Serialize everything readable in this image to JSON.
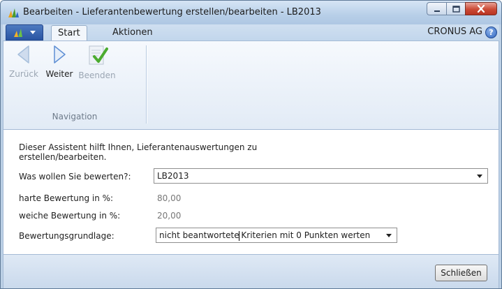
{
  "window": {
    "title": "Bearbeiten - Lieferantenbewertung erstellen/bearbeiten - LB2013"
  },
  "ribbon": {
    "tabs": [
      {
        "label": "Start",
        "active": true
      },
      {
        "label": "Aktionen",
        "active": false
      }
    ],
    "company": "CRONUS AG",
    "help_icon_label": "?",
    "navigation": {
      "group_label": "Navigation",
      "buttons": [
        {
          "label": "Zurück",
          "icon": "arrow-left-icon",
          "enabled": false
        },
        {
          "label": "Weiter",
          "icon": "arrow-right-icon",
          "enabled": true
        },
        {
          "label": "Beenden",
          "icon": "finish-checkmark-icon",
          "enabled": false
        }
      ]
    }
  },
  "form": {
    "intro": "Dieser Assistent hilft Ihnen, Lieferantenauswertungen zu erstellen/bearbeiten.",
    "fields": {
      "evaluate": {
        "label": "Was wollen Sie bewerten?:",
        "value": "LB2013"
      },
      "hard": {
        "label": "harte Bewertung in %:",
        "value": "80,00"
      },
      "soft": {
        "label": "weiche Bewertung in %:",
        "value": "20,00"
      },
      "basis": {
        "label": "Bewertungsgrundlage:",
        "value_before_caret": "nicht beantwortete",
        "value_after_caret": " Kriterien mit 0 Punkten werten"
      }
    }
  },
  "footer": {
    "close_label": "Schließen"
  },
  "colors": {
    "title_bar": "#b8cfe8",
    "close_button": "#cb4a36",
    "app_button": "#2a55a3",
    "nav_arrow_disabled": "#a7bfdc",
    "nav_arrow_enabled": "#5f8fd4",
    "finish_check": "#4bab2f"
  }
}
